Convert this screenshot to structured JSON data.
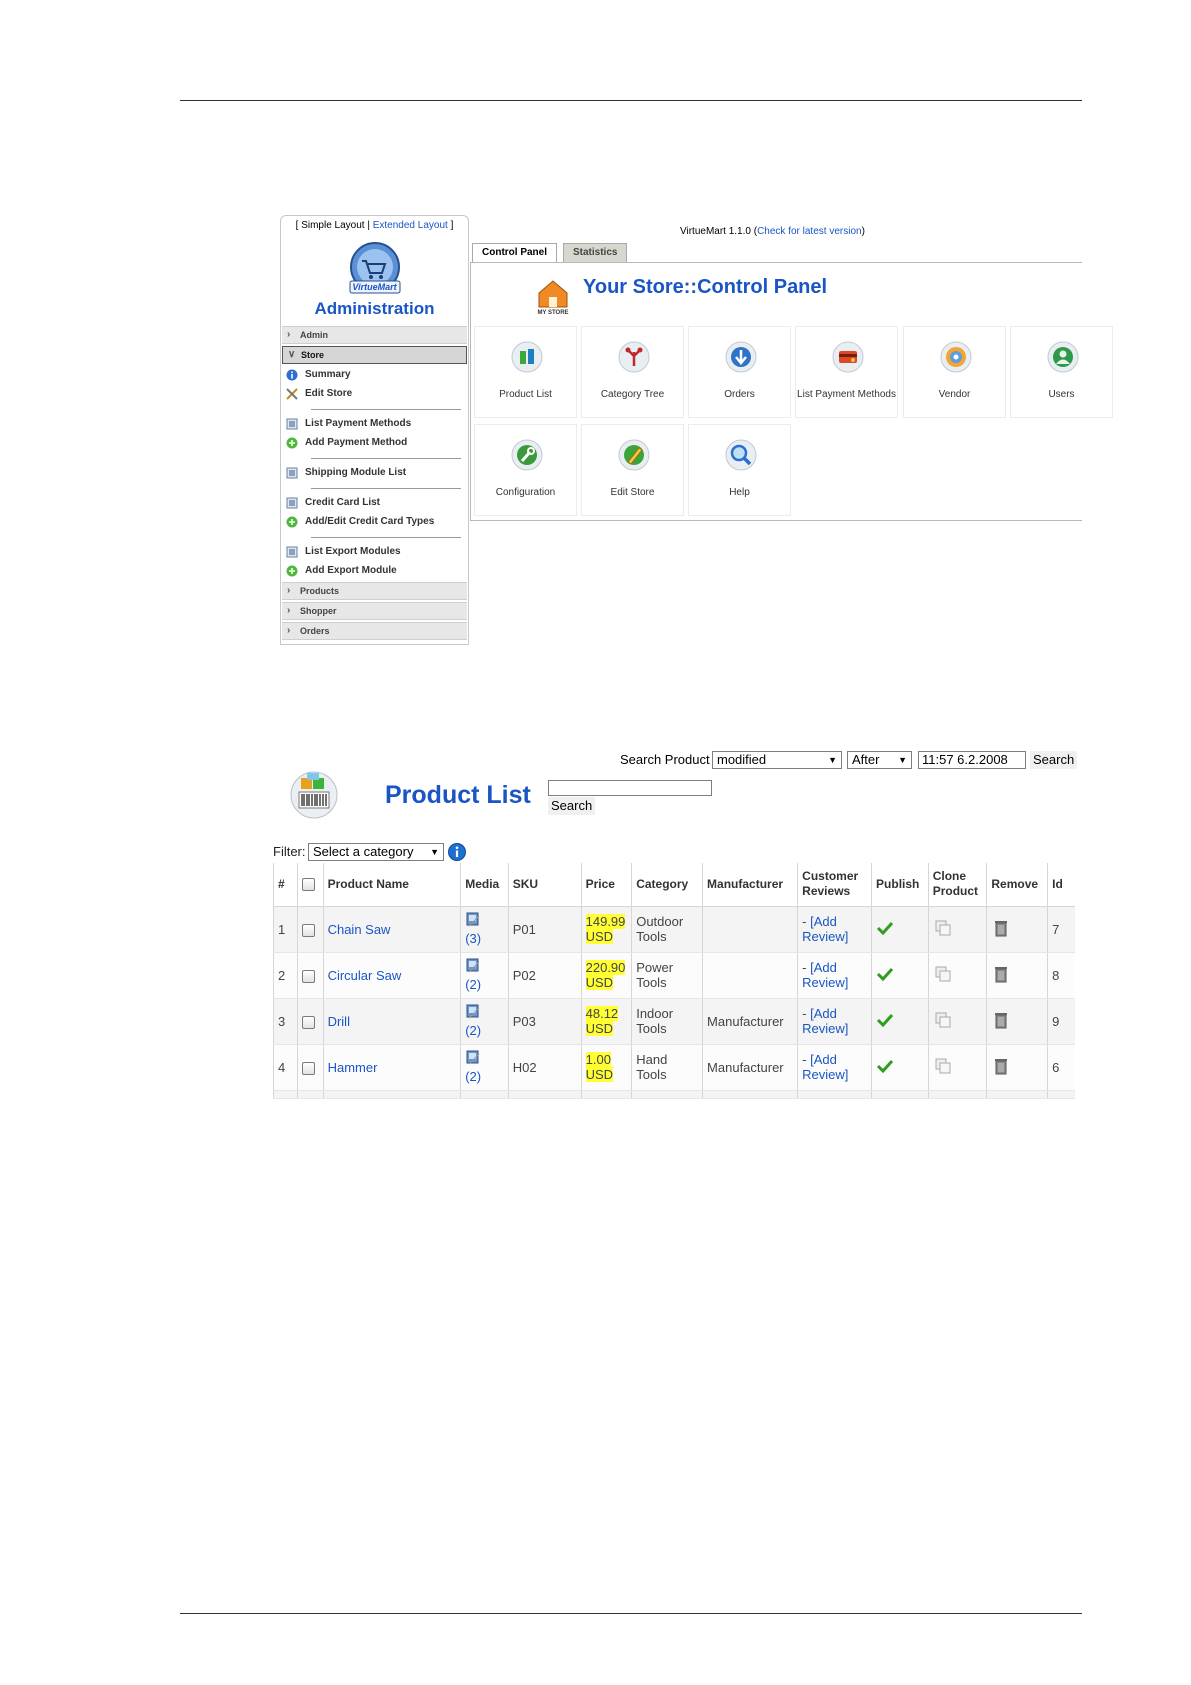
{
  "control_panel": {
    "layout_links": {
      "open": "[",
      "simple": "Simple Layout",
      "divider": "|",
      "extended": "Extended Layout",
      "close": "]"
    },
    "logo_text": "VirtueMart",
    "admin_title": "Administration",
    "sections": {
      "admin": "Admin",
      "store": "Store",
      "products": "Products",
      "shopper": "Shopper",
      "orders": "Orders"
    },
    "store_items": [
      {
        "label": "Summary",
        "icon": "info-icon"
      },
      {
        "label": "Edit Store",
        "icon": "tools-icon"
      },
      {
        "label": "List Payment Methods",
        "icon": "list-icon"
      },
      {
        "label": "Add Payment Method",
        "icon": "add-icon"
      },
      {
        "label": "Shipping Module List",
        "icon": "list-icon"
      },
      {
        "label": "Credit Card List",
        "icon": "list-icon"
      },
      {
        "label": "Add/Edit Credit Card Types",
        "icon": "add-icon"
      },
      {
        "label": "List Export Modules",
        "icon": "list-icon"
      },
      {
        "label": "Add Export Module",
        "icon": "add-icon"
      }
    ],
    "version": {
      "prefix": "VirtueMart 1.1.0 (",
      "link": "Check for latest version",
      "suffix": ")"
    },
    "tabs": [
      "Control Panel",
      "Statistics"
    ],
    "panel_title": "Your Store::Control Panel",
    "store_logo_text": "MY STORE",
    "tiles": [
      {
        "label": "Product List",
        "icon": "product-list-icon"
      },
      {
        "label": "Category Tree",
        "icon": "category-tree-icon"
      },
      {
        "label": "Orders",
        "icon": "orders-icon"
      },
      {
        "label": "List Payment Methods",
        "icon": "payment-methods-icon"
      },
      {
        "label": "Vendor",
        "icon": "vendor-icon"
      },
      {
        "label": "Users",
        "icon": "users-icon"
      },
      {
        "label": "Configuration",
        "icon": "configuration-icon"
      },
      {
        "label": "Edit Store",
        "icon": "edit-store-icon"
      },
      {
        "label": "Help",
        "icon": "help-icon"
      }
    ],
    "colors": {
      "link": "#1a55c5",
      "tab_inactive": "#d7d7cf"
    }
  },
  "product_list": {
    "search_label": "Search Product",
    "search_field_select": "modified",
    "search_when_select": "After",
    "search_date": "11:57 6.2.2008",
    "search_button": "Search",
    "keyword_value": "",
    "keyword_search_button": "Search",
    "title": "Product List",
    "filter_label": "Filter:",
    "filter_select": "Select a category",
    "columns": [
      "#",
      "",
      "Product Name",
      "Media",
      "SKU",
      "Price",
      "Category",
      "Manufacturer",
      "Customer Reviews",
      "Publish",
      "Clone Product",
      "Remove",
      "Id"
    ],
    "rows": [
      {
        "num": "1",
        "name": "Chain Saw",
        "media": "(3)",
        "sku": "P01",
        "price": "149.99",
        "currency": "USD",
        "category": "Outdoor Tools",
        "manufacturer": "",
        "review_dash": "-",
        "review_link": "[Add Review]",
        "id": "7"
      },
      {
        "num": "2",
        "name": "Circular Saw",
        "media": "(2)",
        "sku": "P02",
        "price": "220.90",
        "currency": "USD",
        "category": "Power Tools",
        "manufacturer": "",
        "review_dash": "-",
        "review_link": "[Add Review]",
        "id": "8"
      },
      {
        "num": "3",
        "name": "Drill",
        "media": "(2)",
        "sku": "P03",
        "price": "48.12",
        "currency": "USD",
        "category": "Indoor Tools",
        "manufacturer": "Manufacturer",
        "review_dash": "-",
        "review_link": "[Add Review]",
        "id": "9"
      },
      {
        "num": "4",
        "name": "Hammer",
        "media": "(2)",
        "sku": "H02",
        "price": "1.00",
        "currency": "USD",
        "category": "Hand Tools",
        "manufacturer": "Manufacturer",
        "review_dash": "-",
        "review_link": "[Add Review]",
        "id": "6"
      }
    ],
    "colors": {
      "price_highlight": "#ffff33",
      "title": "#1a55c5",
      "publish_check": "#2e9e1e"
    }
  }
}
